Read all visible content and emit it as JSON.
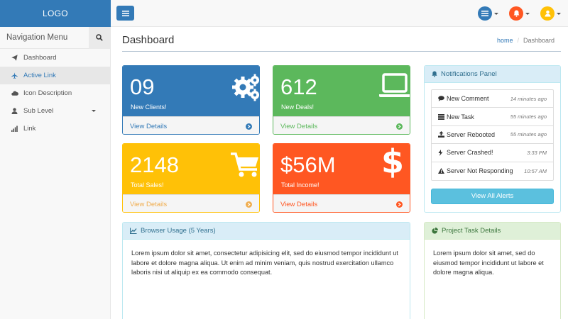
{
  "brand": {
    "logo": "LOGO"
  },
  "sidebar": {
    "title": "Navigation Menu",
    "items": [
      {
        "label": "Dashboard",
        "icon": "paper-plane-icon"
      },
      {
        "label": "Active Link",
        "icon": "plane-icon"
      },
      {
        "label": "Icon Description",
        "icon": "cloud-icon"
      },
      {
        "label": "Sub Level",
        "icon": "user-icon"
      },
      {
        "label": "Link",
        "icon": "signal-icon"
      }
    ]
  },
  "header": {
    "title": "Dashboard",
    "breadcrumb": {
      "home": "home",
      "sep": "/",
      "current": "Dashboard"
    }
  },
  "cards": [
    {
      "value": "09",
      "label": "New Clients!",
      "footer": "View Details",
      "icon": "cogs-icon",
      "color": "#337ab7"
    },
    {
      "value": "612",
      "label": "New Deals!",
      "footer": "View Details",
      "icon": "laptop-icon",
      "color": "#5cb85c"
    },
    {
      "value": "2148",
      "label": "Total Sales!",
      "footer": "View Details",
      "icon": "shopping-cart-icon",
      "color": "#ffc107"
    },
    {
      "value": "$56M",
      "label": "Total Income!",
      "footer": "View Details",
      "icon": "dollar-icon",
      "color": "#ff5722"
    }
  ],
  "notifications": {
    "title": "Notifications Panel",
    "items": [
      {
        "text": "New Comment",
        "time": "14 minutes ago",
        "icon": "comment-icon"
      },
      {
        "text": "New Task",
        "time": "55 minutes ago",
        "icon": "tasks-icon"
      },
      {
        "text": "Server Rebooted",
        "time": "55 minutes ago",
        "icon": "upload-icon"
      },
      {
        "text": "Server Crashed!",
        "time": "3:33 PM",
        "icon": "bolt-icon"
      },
      {
        "text": "Server Not Responding",
        "time": "10:57 AM",
        "icon": "warning-icon"
      }
    ],
    "button": "View All Alerts"
  },
  "browser_panel": {
    "title": "Browser Usage (5 Years)",
    "body": "Lorem ipsum dolor sit amet, consectetur adipisicing elit, sed do eiusmod tempor incididunt ut labore et dolore magna aliqua. Ut enim ad minim veniam, quis nostrud exercitation ullamco laboris nisi ut aliquip ex ea commodo consequat."
  },
  "task_panel": {
    "title": "Project Task Details",
    "body": "Lorem ipsum dolor sit amet, sed do eiusmod tempor incididunt ut labore et dolore magna aliqua."
  },
  "colors": {
    "primary": "#337ab7",
    "success": "#5cb85c",
    "warning": "#ffc107",
    "danger": "#ff5722",
    "info": "#5bc0de"
  }
}
